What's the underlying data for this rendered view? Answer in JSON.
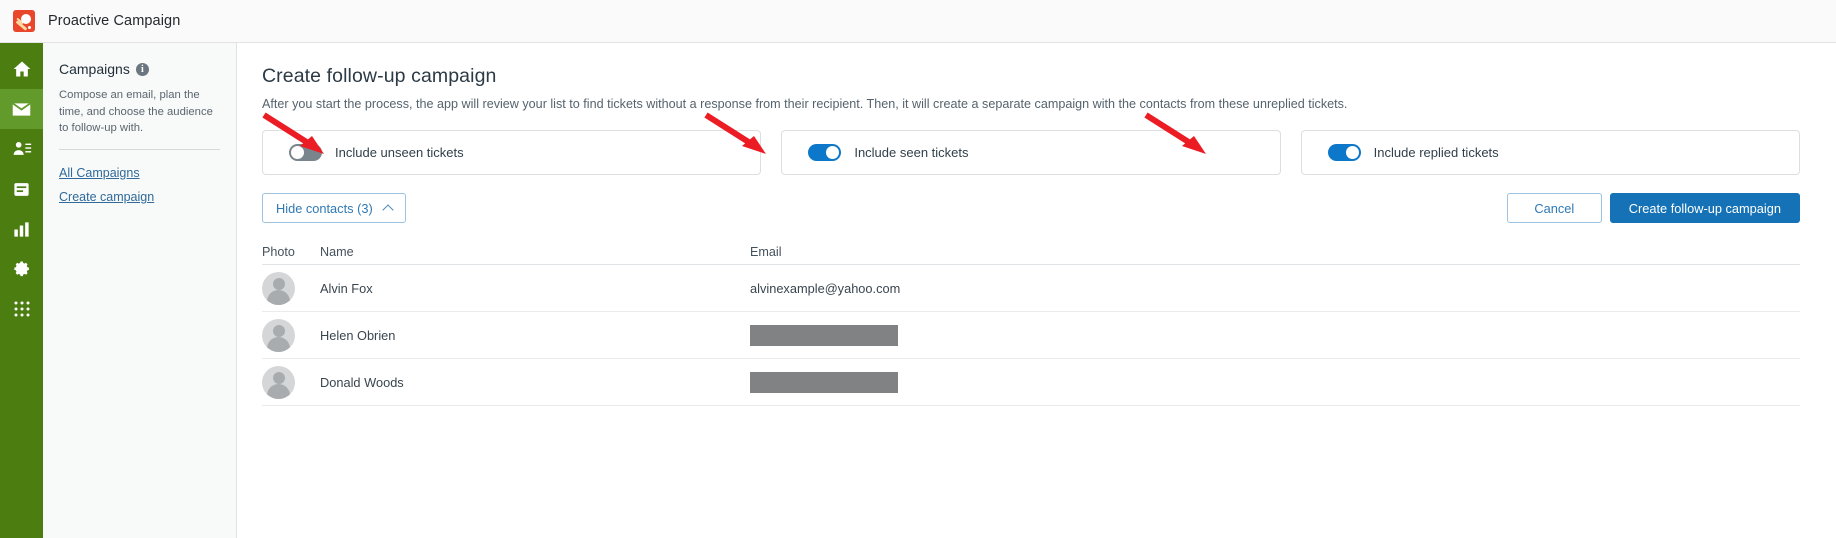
{
  "titlebar": {
    "app_name": "Proactive Campaign",
    "logo_icon": "proactive-campaign-logo"
  },
  "rail": {
    "items": [
      {
        "icon": "home-icon",
        "name": "home",
        "active": false
      },
      {
        "icon": "mail-icon",
        "name": "mail",
        "active": true
      },
      {
        "icon": "contacts-icon",
        "name": "contacts",
        "active": false
      },
      {
        "icon": "inbox-icon",
        "name": "inbox",
        "active": false
      },
      {
        "icon": "chart-icon",
        "name": "reports",
        "active": false
      },
      {
        "icon": "gear-icon",
        "name": "settings",
        "active": false
      },
      {
        "icon": "apps-grid-icon",
        "name": "apps",
        "active": false
      }
    ]
  },
  "panel": {
    "title": "Campaigns",
    "info_icon": "info-icon",
    "description": "Compose an email, plan the time, and choose the audience to follow-up with.",
    "links": [
      {
        "label": "All Campaigns"
      },
      {
        "label": "Create campaign"
      }
    ]
  },
  "main": {
    "title": "Create follow-up campaign",
    "subtitle": "After you start the process, the app will review your list to find tickets without a response from their recipient. Then, it will create a separate campaign with the contacts from these unreplied tickets.",
    "toggles": [
      {
        "label": "Include unseen tickets",
        "on": false
      },
      {
        "label": "Include seen tickets",
        "on": true
      },
      {
        "label": "Include replied tickets",
        "on": true
      }
    ],
    "hide_contacts_label": "Hide contacts (3)",
    "hide_contacts_icon": "chevron-up-icon",
    "cancel_label": "Cancel",
    "create_label": "Create follow-up campaign",
    "table": {
      "columns": [
        "Photo",
        "Name",
        "Email"
      ],
      "rows": [
        {
          "name": "Alvin Fox",
          "email": "alvinexample@yahoo.com",
          "redacted": false
        },
        {
          "name": "Helen Obrien",
          "email": "",
          "redacted": true
        },
        {
          "name": "Donald Woods",
          "email": "",
          "redacted": true
        }
      ]
    }
  },
  "colors": {
    "rail_green": "#4b7d10",
    "rail_active_green": "#639a2c",
    "accent_blue": "#1572b6",
    "toggle_on": "#0d78c9",
    "toggle_off": "#7a848c",
    "annotation_red": "#ec1c24"
  }
}
